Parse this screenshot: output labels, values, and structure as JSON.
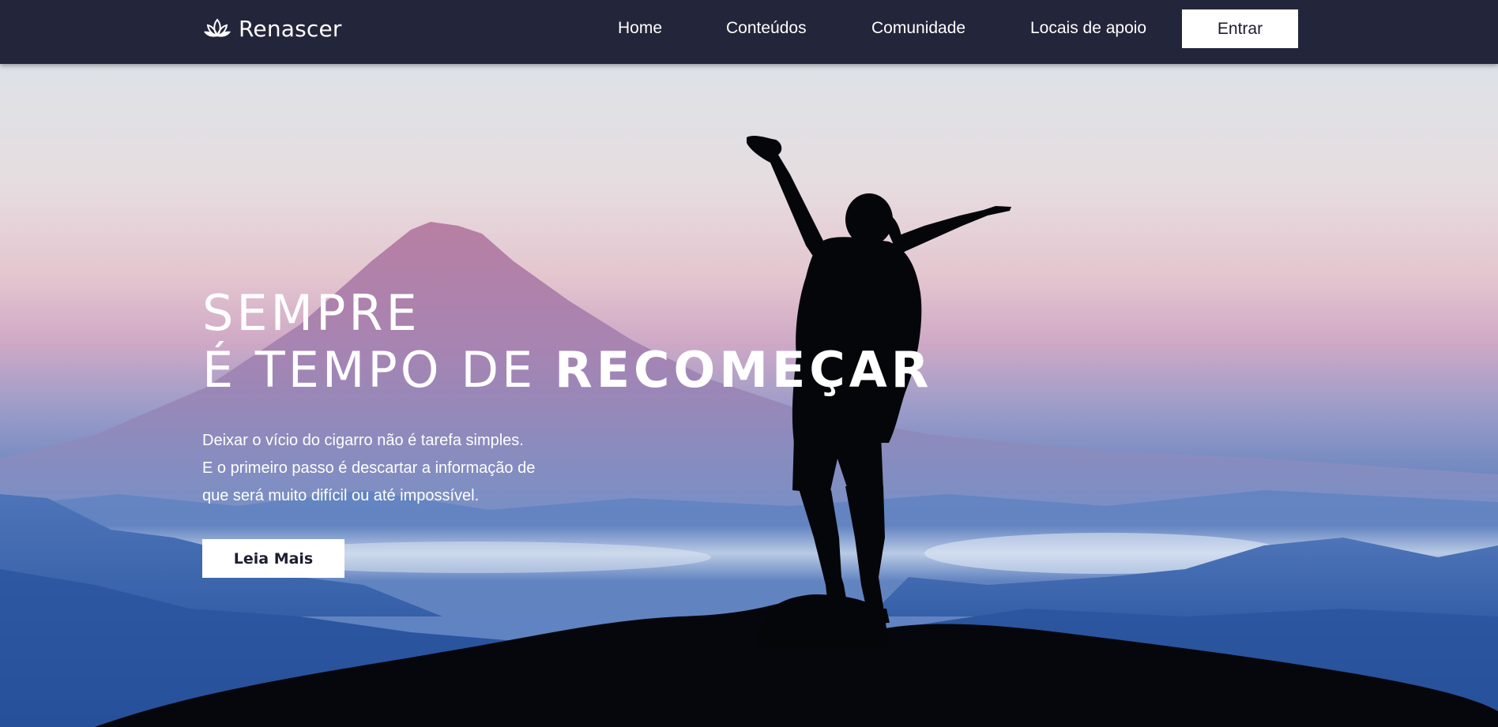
{
  "brand": {
    "name": "Renascer",
    "logo_icon": "lotus-icon"
  },
  "nav": {
    "items": [
      {
        "label": "Home"
      },
      {
        "label": "Conteúdos"
      },
      {
        "label": "Comunidade"
      },
      {
        "label": "Locais de apoio"
      }
    ],
    "login_label": "Entrar"
  },
  "hero": {
    "title_line1": "SEMPRE",
    "title_line2_prefix": "É TEMPO DE ",
    "title_line2_strong": "RECOMEÇAR",
    "description": [
      "Deixar o vício do cigarro não é tarefa simples.",
      "E o primeiro passo é descartar a informação de",
      "que será muito difícil ou até impossível."
    ],
    "cta_label": "Leia Mais"
  },
  "colors": {
    "navbar": "#23253a",
    "button_bg": "#ffffff",
    "button_text": "#1c1e30",
    "sky_top": "#dfe3e8",
    "sky_pink": "#d9b3c4",
    "mountain_blue": "#3c67ae"
  }
}
